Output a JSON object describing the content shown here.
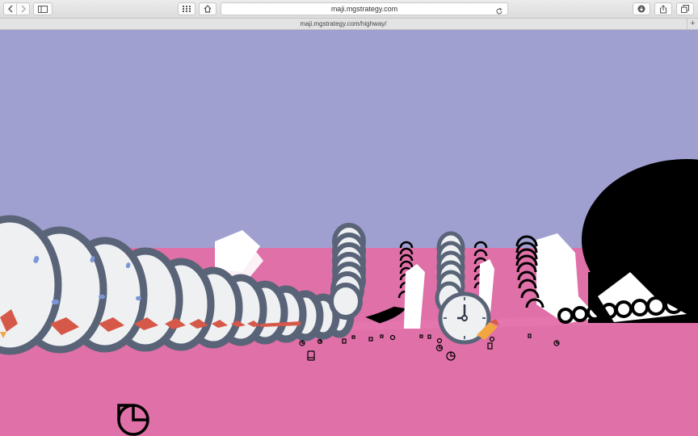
{
  "browser": {
    "address_url": "maji.mgstrategy.com",
    "tab_title": "maji.mgstrategy.com/highway/",
    "new_tab_symbol": "+",
    "icons": {
      "back": "chevron-left-icon",
      "forward": "chevron-right-icon",
      "sidebar": "sidebar-icon",
      "top_sites": "grid-icon",
      "home": "home-icon",
      "reload": "reload-icon",
      "downloads": "download-icon",
      "share": "share-icon",
      "tabs": "tabs-overview-icon"
    }
  },
  "scene": {
    "colors": {
      "sky": "#9fa0d0",
      "ground": "#e070a8",
      "tube_ring": "#5a6478",
      "tube_inner": "#eef0f2",
      "pencil_red": "#d65848",
      "pencil_yellow": "#f2a640",
      "clock_face": "#eef0f2",
      "icon_black": "#000000"
    },
    "icons": [
      "clock-icon",
      "pie-chart-icon",
      "pencil-icon",
      "tablet-icon",
      "document-icon"
    ]
  }
}
